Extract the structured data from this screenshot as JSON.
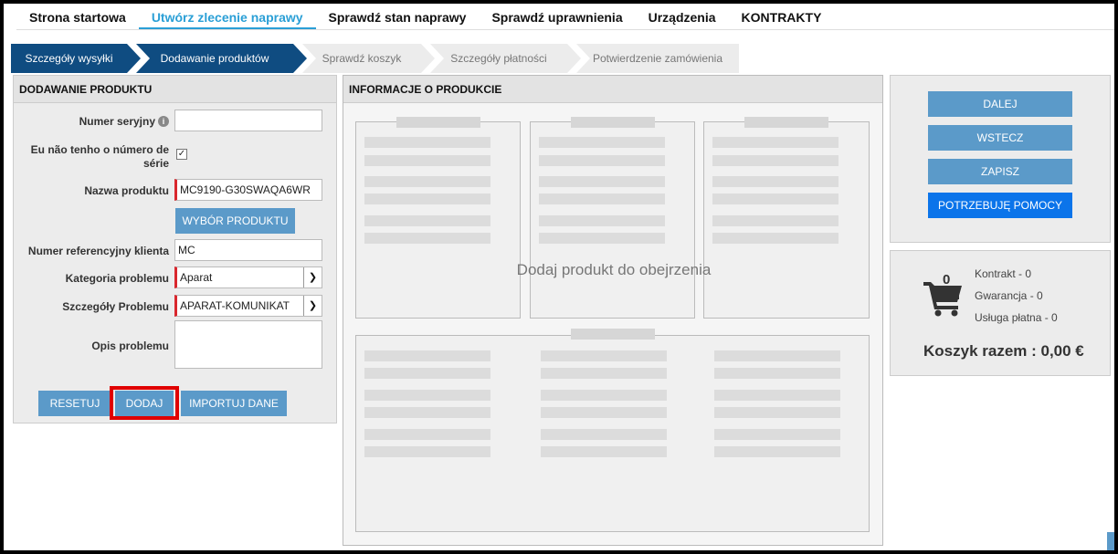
{
  "nav": {
    "items": [
      "Strona startowa",
      "Utwórz zlecenie naprawy",
      "Sprawdź stan naprawy",
      "Sprawdź uprawnienia",
      "Urządzenia",
      "KONTRAKTY"
    ],
    "active_index": 1
  },
  "steps": [
    "Szczegóły wysyłki",
    "Dodawanie produktów",
    "Sprawdź koszyk",
    "Szczegóły płatności",
    "Potwierdzenie zamówienia"
  ],
  "add_product": {
    "title": "DODAWANIE PRODUKTU",
    "serial_label": "Numer seryjny",
    "serial_value": "",
    "no_serial_label_1": "Eu não tenho o número de",
    "no_serial_label_2": "série",
    "no_serial_checked": "✓",
    "product_name_label": "Nazwa produktu",
    "product_name_value": "MC9190-G30SWAQA6WR",
    "select_product_button": "WYBÓR PRODUKTU",
    "customer_ref_label": "Numer referencyjny klienta",
    "customer_ref_value": "MC",
    "problem_category_label": "Kategoria problemu",
    "problem_category_value": "Aparat",
    "problem_details_label": "Szczegóły Problemu",
    "problem_details_value": "APARAT-KOMUNIKAT",
    "problem_description_label": "Opis problemu",
    "problem_description_value": "",
    "reset_button": "RESETUJ",
    "add_button": "DODAJ",
    "import_button": "IMPORTUJ DANE"
  },
  "product_info": {
    "title": "INFORMACJE O PRODUKCIE",
    "placeholder": "Dodaj produkt do obejrzenia"
  },
  "actions": {
    "next": "DALEJ",
    "back": "WSTECZ",
    "save": "ZAPISZ",
    "help": "POTRZEBUJĘ POMOCY"
  },
  "cart": {
    "count": "0",
    "contract": "Kontrakt - 0",
    "warranty": "Gwarancja - 0",
    "paid_service": "Usługa płatna - 0",
    "total": "Koszyk razem : 0,00 €"
  },
  "colors": {
    "accent": "#2a9fd6",
    "step_done": "#0f4c81",
    "button": "#5b9ac9",
    "help_button": "#0b74ea",
    "required": "#d9272e",
    "highlight": "#e00000"
  }
}
